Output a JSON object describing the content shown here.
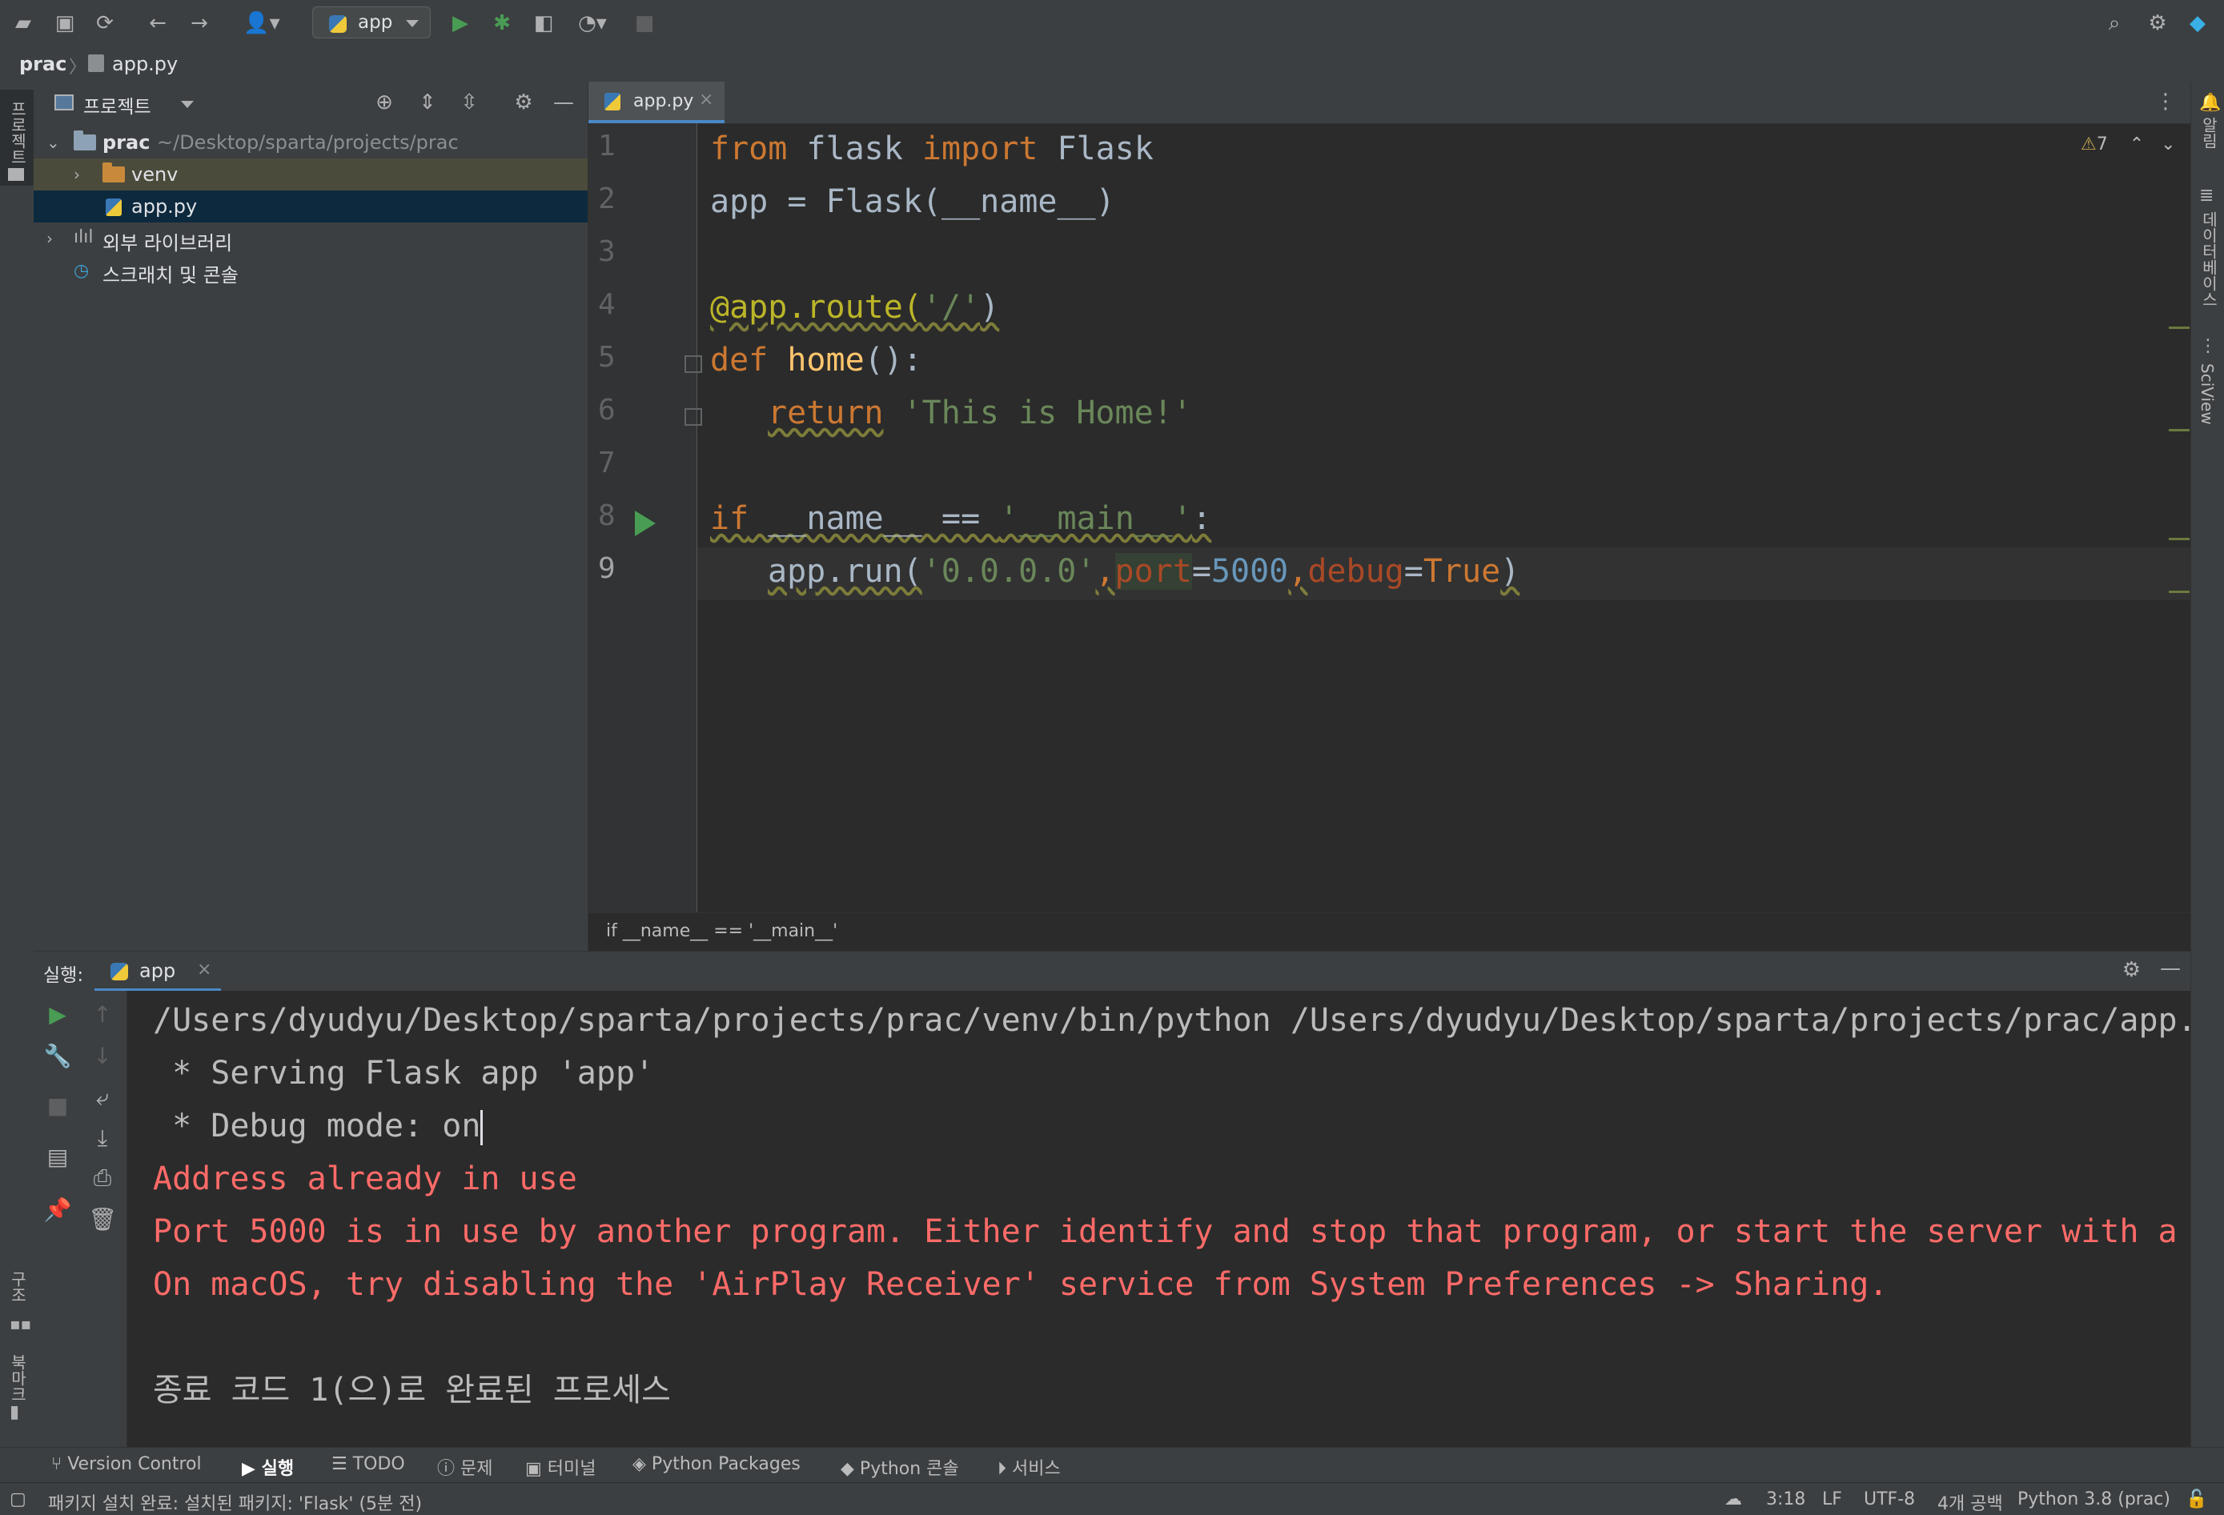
{
  "toolbar": {
    "run_config": "app",
    "icons": [
      "open-folder-icon",
      "save-icon",
      "sync-icon",
      "back-icon",
      "forward-icon",
      "user-icon",
      "run-icon",
      "debug-icon",
      "coverage-icon",
      "profile-icon",
      "stop-icon",
      "search-icon",
      "gear-icon",
      "logo-icon"
    ]
  },
  "breadcrumb": {
    "project": "prac",
    "file": "app.py"
  },
  "left_strip": {
    "project_label": "프로젝트",
    "structure_label": "구조",
    "bookmarks_label": "북마크"
  },
  "right_strip": {
    "notifications_label": "알림",
    "database_label": "데이터베이스",
    "sciview_label": "SciView"
  },
  "project_panel": {
    "title": "프로젝트",
    "tree": [
      {
        "label": "prac",
        "path": "~/Desktop/sparta/projects/prac"
      },
      {
        "label": "venv"
      },
      {
        "label": "app.py"
      },
      {
        "label": "외부 라이브러리"
      },
      {
        "label": "스크래치 및 콘솔"
      }
    ]
  },
  "editor": {
    "tab": "app.py",
    "warnings": "7",
    "line_numbers": [
      "1",
      "2",
      "3",
      "4",
      "5",
      "6",
      "7",
      "8",
      "9"
    ],
    "lines": {
      "l1": {
        "a": "from",
        "b": " flask ",
        "c": "import",
        "d": " Flask"
      },
      "l2": "app = Flask(__name__)",
      "l4": {
        "a": "@app.route(",
        "b": "'/'",
        "c": ")"
      },
      "l5": {
        "a": "def",
        "b": " ",
        "c": "home",
        "d": "():"
      },
      "l6": {
        "a": "return",
        "b": " ",
        "c": "'This is Home!'"
      },
      "l8": {
        "a": "if",
        "b": " __name__ == ",
        "c": "'__main__'",
        "d": ":"
      },
      "l9": {
        "a": "app.run(",
        "b": "'0.0.0.0'",
        "c": ",",
        "d": "port",
        "e": "=",
        "f": "5000",
        "g": ",",
        "h": "debug",
        "i": "=",
        "j": "True",
        "k": ")"
      }
    },
    "footer_context": "if __name__ == '__main__'"
  },
  "run_panel": {
    "label": "실행:",
    "tab": "app",
    "output": [
      "/Users/dyudyu/Desktop/sparta/projects/prac/venv/bin/python /Users/dyudyu/Desktop/sparta/projects/prac/app.",
      " * Serving Flask app 'app'",
      " * Debug mode: on"
    ],
    "errors": [
      "Address already in use",
      "Port 5000 is in use by another program. Either identify and stop that program, or start the server with a",
      "On macOS, try disabling the 'AirPlay Receiver' service from System Preferences -> Sharing."
    ],
    "exit_message": "종료 코드 1(으)로 완료된 프로세스"
  },
  "bottom_tabs": [
    "Version Control",
    "실행",
    "TODO",
    "문제",
    "터미널",
    "Python Packages",
    "Python 콘솔",
    "서비스"
  ],
  "status_bar": {
    "message": "패키지 설치 완료: 설치된 패키지: 'Flask' (5분 전)",
    "position": "3:18",
    "line_sep": "LF",
    "encoding": "UTF-8",
    "indent": "4개 공백",
    "interpreter": "Python 3.8 (prac)"
  },
  "colors": {
    "accent": "#4a88c7",
    "error": "#ff6b68",
    "keyword": "#cc7832",
    "string": "#6a8759",
    "number": "#6897bb"
  }
}
